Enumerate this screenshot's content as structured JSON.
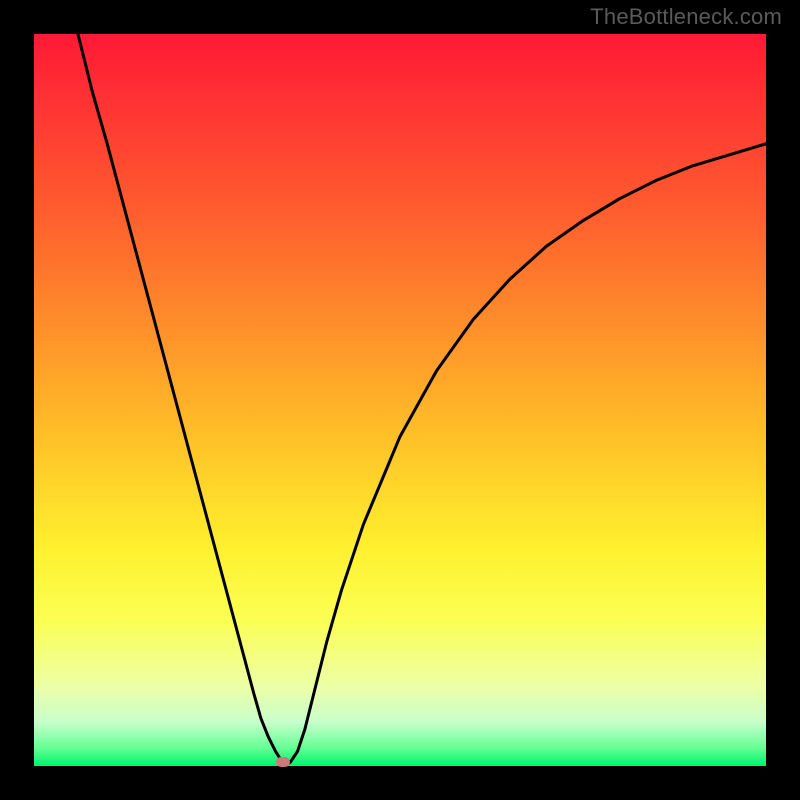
{
  "watermark": "TheBottleneck.com",
  "chart_data": {
    "type": "line",
    "title": "",
    "xlabel": "",
    "ylabel": "",
    "xlim": [
      0,
      100
    ],
    "ylim": [
      0,
      100
    ],
    "grid": false,
    "legend": false,
    "background_gradient": [
      "#ff1935",
      "#00f36b"
    ],
    "series": [
      {
        "name": "curve",
        "x": [
          6,
          8,
          10,
          12,
          14,
          16,
          18,
          20,
          22,
          24,
          26,
          28,
          30,
          31,
          32,
          33,
          33.5,
          34,
          34.5,
          35,
          36,
          37,
          38,
          40,
          42,
          45,
          50,
          55,
          60,
          65,
          70,
          75,
          80,
          85,
          90,
          95,
          100
        ],
        "y": [
          100,
          92,
          85,
          77.5,
          70,
          62.5,
          55,
          47.5,
          40,
          32.5,
          25,
          17.5,
          10,
          6.5,
          4,
          2,
          1.2,
          0.6,
          0.2,
          0.5,
          2,
          5,
          9,
          17,
          24,
          33,
          45,
          54,
          61,
          66.5,
          71,
          74.5,
          77.5,
          80,
          82,
          83.5,
          85
        ]
      }
    ],
    "marker": {
      "x": 34,
      "y": 0.5,
      "color": "#c97a7a"
    }
  }
}
